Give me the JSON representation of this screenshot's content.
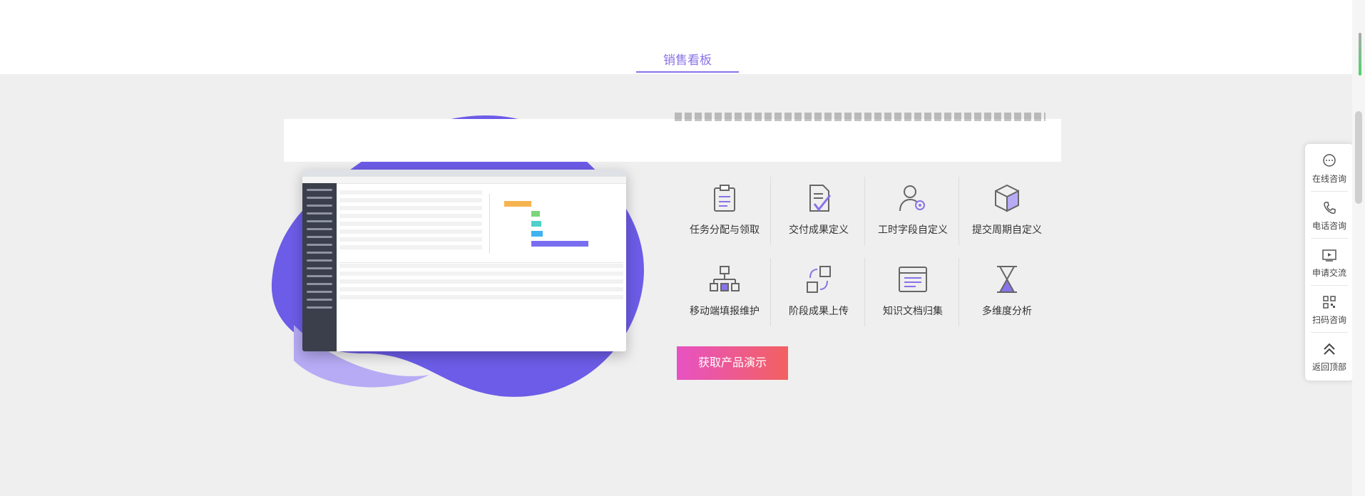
{
  "tabs": {
    "active": "销售看板"
  },
  "features": [
    {
      "label": "任务分配与领取",
      "icon": "clipboard-icon"
    },
    {
      "label": "交付成果定义",
      "icon": "document-check-icon"
    },
    {
      "label": "工时字段自定义",
      "icon": "user-gear-icon"
    },
    {
      "label": "提交周期自定义",
      "icon": "cube-icon"
    },
    {
      "label": "移动端填报维护",
      "icon": "hierarchy-icon"
    },
    {
      "label": "阶段成果上传",
      "icon": "stage-upload-icon"
    },
    {
      "label": "知识文档归集",
      "icon": "browser-window-icon"
    },
    {
      "label": "多维度分析",
      "icon": "hourglass-icon"
    }
  ],
  "cta": {
    "label": "获取产品演示"
  },
  "side_panel": [
    {
      "label": "在线咨询",
      "icon": "chat-bubble-icon"
    },
    {
      "label": "电话咨询",
      "icon": "phone-icon"
    },
    {
      "label": "申请交流",
      "icon": "video-play-icon"
    },
    {
      "label": "扫码咨询",
      "icon": "qr-code-icon"
    },
    {
      "label": "返回顶部",
      "icon": "double-chevron-up-icon"
    }
  ],
  "colors": {
    "accent": "#8a72e8",
    "blob_dark": "#6c5ce7",
    "blob_light": "#b7abf5",
    "cta_start": "#e752c3",
    "cta_end": "#f26160"
  }
}
